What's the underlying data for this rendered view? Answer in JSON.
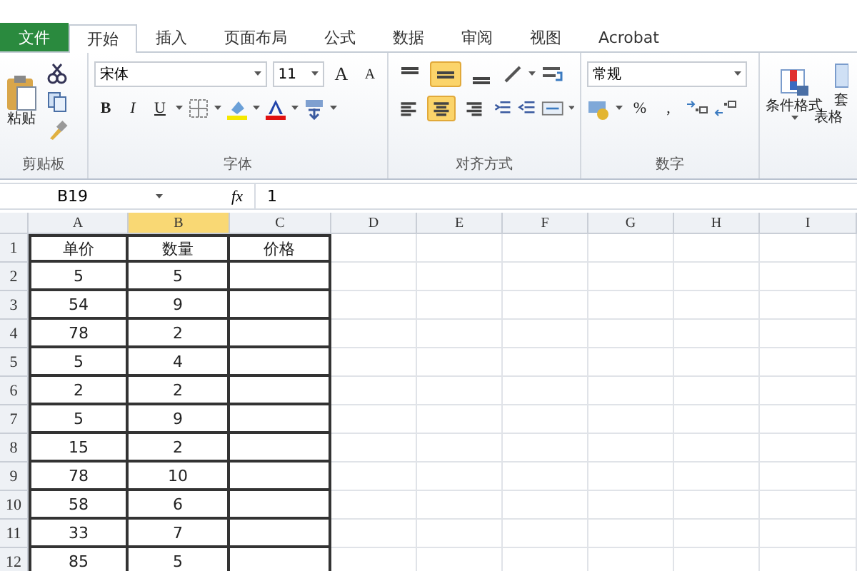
{
  "tabs": [
    {
      "label": "文件",
      "kind": "file",
      "selected": false
    },
    {
      "label": "开始",
      "kind": "tab",
      "selected": true
    },
    {
      "label": "插入",
      "kind": "tab",
      "selected": false
    },
    {
      "label": "页面布局",
      "kind": "tab",
      "selected": false
    },
    {
      "label": "公式",
      "kind": "tab",
      "selected": false
    },
    {
      "label": "数据",
      "kind": "tab",
      "selected": false
    },
    {
      "label": "审阅",
      "kind": "tab",
      "selected": false
    },
    {
      "label": "视图",
      "kind": "tab",
      "selected": false
    },
    {
      "label": "Acrobat",
      "kind": "tab",
      "selected": false
    }
  ],
  "ribbon": {
    "clipboard": {
      "paste": "粘贴",
      "label": "剪贴板"
    },
    "font": {
      "name": "宋体",
      "size": "11",
      "grow": "A",
      "shrink": "A",
      "styles": [
        "B",
        "I",
        "U"
      ],
      "label": "字体"
    },
    "alignment": {
      "top_row": [
        {
          "kind": "top",
          "selected": false
        },
        {
          "kind": "middle",
          "selected": true
        },
        {
          "kind": "bottom",
          "selected": false
        }
      ],
      "bottom_row": [
        {
          "kind": "left",
          "selected": false
        },
        {
          "kind": "center",
          "selected": true
        },
        {
          "kind": "right",
          "selected": false
        }
      ],
      "label": "对齐方式"
    },
    "number": {
      "format": "常规",
      "percent": "%",
      "comma": ",",
      "label": "数字"
    },
    "styles": {
      "conditional": "条件格式",
      "table_top": "套",
      "table_bottom": "表格"
    }
  },
  "formula_bar": {
    "name_box": "B19",
    "fx": "fx",
    "value": "1"
  },
  "sheet": {
    "columns": [
      {
        "label": "A",
        "selected": false
      },
      {
        "label": "B",
        "selected": true
      },
      {
        "label": "C",
        "selected": false
      },
      {
        "label": "D",
        "selected": false
      },
      {
        "label": "E",
        "selected": false
      },
      {
        "label": "F",
        "selected": false
      },
      {
        "label": "G",
        "selected": false
      },
      {
        "label": "H",
        "selected": false
      },
      {
        "label": "I",
        "selected": false
      }
    ],
    "rows": [
      {
        "number": "1",
        "cells": [
          "单价",
          "数量",
          "价格"
        ]
      },
      {
        "number": "2",
        "cells": [
          "5",
          "5"
        ]
      },
      {
        "number": "3",
        "cells": [
          "54",
          "9"
        ]
      },
      {
        "number": "4",
        "cells": [
          "78",
          "2"
        ]
      },
      {
        "number": "5",
        "cells": [
          "5",
          "4"
        ]
      },
      {
        "number": "6",
        "cells": [
          "2",
          "2"
        ]
      },
      {
        "number": "7",
        "cells": [
          "5",
          "9"
        ]
      },
      {
        "number": "8",
        "cells": [
          "15",
          "2"
        ]
      },
      {
        "number": "9",
        "cells": [
          "78",
          "10"
        ]
      },
      {
        "number": "10",
        "cells": [
          "58",
          "6"
        ]
      },
      {
        "number": "11",
        "cells": [
          "33",
          "7"
        ]
      },
      {
        "number": "12",
        "cells": [
          "85",
          "5"
        ]
      }
    ]
  }
}
